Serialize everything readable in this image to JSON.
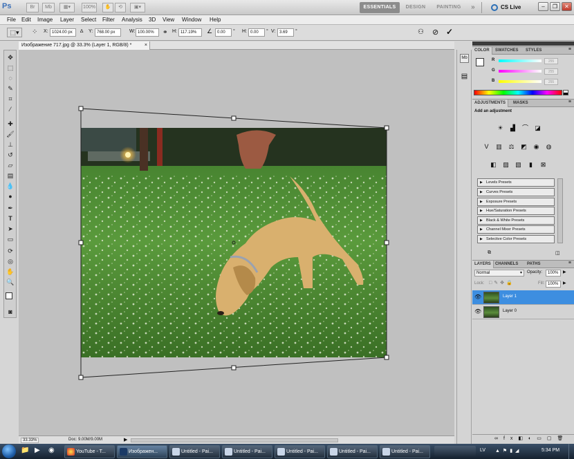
{
  "appbar": {
    "logo": "Ps",
    "tools": [
      "Br",
      "Mb",
      "100%"
    ],
    "workspaces": [
      "ESSENTIALS",
      "DESIGN",
      "PAINTING"
    ],
    "cs_live": "CS Live"
  },
  "menu": [
    "File",
    "Edit",
    "Image",
    "Layer",
    "Select",
    "Filter",
    "Analysis",
    "3D",
    "View",
    "Window",
    "Help"
  ],
  "options": {
    "x_label": "X:",
    "x_value": "1024.00 px",
    "y_label": "Y:",
    "y_value": "768.00 px",
    "w_label": "W:",
    "w_value": "100.00%",
    "h_label": "H:",
    "h_value": "117.19%",
    "angle_value": "0.00",
    "h_skew_label": "H:",
    "h_skew_value": "0.00",
    "v_skew_label": "V:",
    "v_skew_value": "3.69",
    "degree_symbol": "°"
  },
  "document": {
    "tab_title": "Изображение 717.jpg @ 33.3% (Layer 1, RGB/8) *",
    "zoom": "33.33%",
    "doc_size": "Doc: 9.00M/9.00M"
  },
  "panels": {
    "color_tabs": [
      "COLOR",
      "SWATCHES",
      "STYLES"
    ],
    "channels": [
      {
        "label": "R",
        "value": "255",
        "gradient": "linear-gradient(90deg,#00ffff,#ffffff)"
      },
      {
        "label": "G",
        "value": "255",
        "gradient": "linear-gradient(90deg,#ff00ff,#ffffff)"
      },
      {
        "label": "B",
        "value": "255",
        "gradient": "linear-gradient(90deg,#ffff00,#ffffff)"
      }
    ],
    "adjust_tabs": [
      "ADJUSTMENTS",
      "MASKS"
    ],
    "add_adjustment": "Add an adjustment",
    "presets": [
      "Levels Presets",
      "Curves Presets",
      "Exposure Presets",
      "Hue/Saturation Presets",
      "Black & White Presets",
      "Channel Mixer Presets",
      "Selective Color Presets"
    ],
    "layers_tabs": [
      "LAYERS",
      "CHANNELS",
      "PATHS"
    ],
    "blend_mode": "Normal",
    "opacity_label": "Opacity:",
    "opacity_value": "100%",
    "lock_label": "Lock:",
    "fill_label": "Fill:",
    "fill_value": "100%",
    "layers": [
      {
        "name": "Layer 1",
        "selected": true
      },
      {
        "name": "Layer 0",
        "selected": false
      }
    ]
  },
  "taskbar": {
    "items": [
      "YouTube - T...",
      "Изображен...",
      "Untitled - Pai...",
      "Untitled - Pai...",
      "Untitled - Pai...",
      "Untitled - Pai...",
      "Untitled - Pai..."
    ],
    "language": "LV",
    "time": "5:34 PM"
  },
  "colors": {
    "accent_selected": "#3d8ee0",
    "canvas_bg": "#c0c0c0",
    "grass": "#4f8a33",
    "dog": "#d9b06e"
  }
}
